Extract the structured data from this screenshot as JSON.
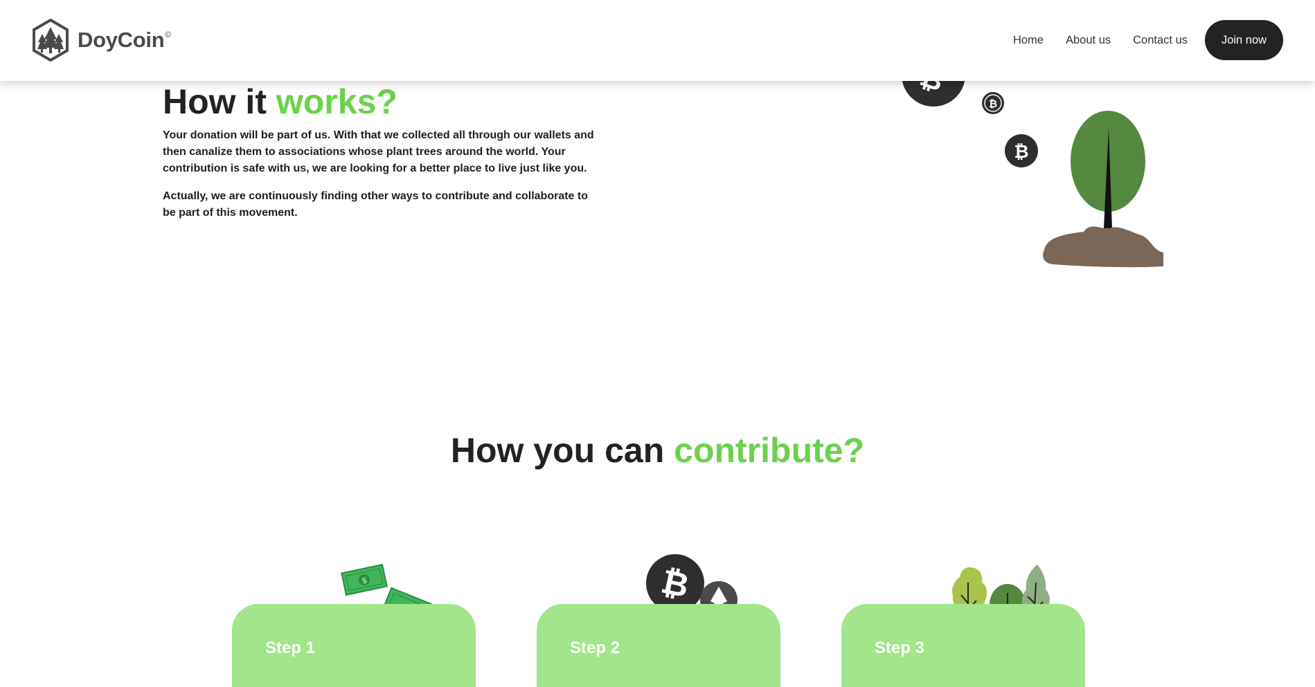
{
  "header": {
    "logo_text": "DoyCoin",
    "logo_mark": "©",
    "nav": [
      "Home",
      "About us",
      "Contact us"
    ],
    "join_label": "Join now"
  },
  "how_it_works": {
    "title_main": "How it ",
    "title_accent": "works?",
    "paragraph_1": "Your donation will be part of us. With that we collected all through our wallets and then canalize them to associations whose plant trees around the world. Your contribution is safe with us, we are looking for a better place to live just like you.",
    "paragraph_2": "Actually, we are continuously finding other ways to contribute and collaborate to be part of this movement."
  },
  "contribute": {
    "title_main": "How you can ",
    "title_accent": "contribute?",
    "steps": [
      {
        "label": "Step 1",
        "icon": "money-bills-icon"
      },
      {
        "label": "Step 2",
        "icon": "crypto-coins-icon"
      },
      {
        "label": "Step 3",
        "icon": "trees-icon"
      }
    ]
  },
  "colors": {
    "accent_green": "#6ad24c",
    "card_green": "#a2e58a",
    "dark": "#232323"
  }
}
